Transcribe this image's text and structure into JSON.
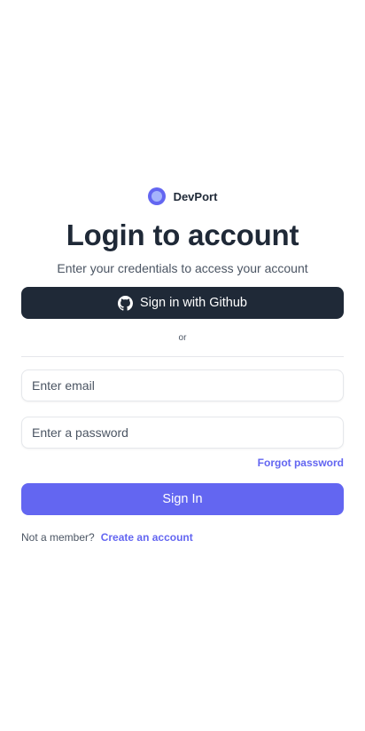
{
  "brand": {
    "name": "DevPort",
    "logo_icon": "circle-logo-icon",
    "color": "#6366f1"
  },
  "title": "Login to account",
  "subtitle": "Enter your credentials to access your account",
  "github_button": {
    "label": "Sign in with Github",
    "icon": "github-icon",
    "background": "#1f2937"
  },
  "divider_text": "or",
  "email": {
    "placeholder": "Enter email",
    "value": ""
  },
  "password": {
    "placeholder": "Enter a password",
    "value": ""
  },
  "forgot_password": "Forgot password",
  "signin_button": {
    "label": "Sign In",
    "background": "#6366f1"
  },
  "footer": {
    "prompt": "Not a member?",
    "create_link": "Create an account"
  }
}
